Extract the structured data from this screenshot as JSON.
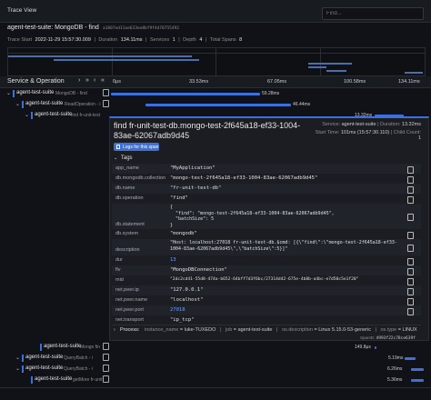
{
  "panel": {
    "title": "Trace View"
  },
  "search": {
    "placeholder": "Find..."
  },
  "trace": {
    "name": "agent-test-suite: MongoDB - find",
    "id": "a1807ed11ae633ee8bf9f4d70755492",
    "start_label": "Trace Start",
    "start_value": "2022-11-29 15:57:30.009",
    "duration_label": "Duration",
    "duration_value": "134.11ms",
    "services_label": "Services",
    "services_value": "1",
    "depth_label": "Depth",
    "depth_value": "4",
    "total_spans_label": "Total Spans",
    "total_spans_value": "8"
  },
  "header": {
    "col_label": "Service & Operation",
    "ticks": [
      "0μs",
      "33.53ms",
      "67.05ms",
      "100.58ms",
      "134.11ms"
    ]
  },
  "spans": [
    {
      "service": "agent-test-suite",
      "op": "MongoDB - find",
      "duration": "59.28ms",
      "depth": 0
    },
    {
      "service": "agent-test-suite",
      "op": "ReadOperation - i",
      "duration": "46.44ms",
      "depth": 1
    },
    {
      "service": "agent-test-suite",
      "op": "find fr-unit-test",
      "duration": "13.32ms",
      "depth": 2
    }
  ],
  "detail": {
    "title": "find fr-unit-test-db.mongo-test-2f645a18-ef33-1004-83ae-62067adb9d45",
    "logs_button": "Logs for this span",
    "service_label": "Service:",
    "service_value": "agent-test-suite",
    "duration_label": "Duration:",
    "duration_value": "13.32ms",
    "start_label": "Start Time:",
    "start_value": "101ms (15:57:30.110)",
    "child_label": "Child Count:",
    "child_value": "1",
    "tags_label": "Tags",
    "tags": [
      {
        "key": "app_name",
        "value": "\"MyApplication\""
      },
      {
        "key": "db.mongodb.collection",
        "value": "\"mongo-test-2f645a18-ef33-1004-83ae-62067adb9d45\""
      },
      {
        "key": "db.name",
        "value": "\"fr-unit-test-db\""
      },
      {
        "key": "db.operation",
        "value": "\"find\""
      },
      {
        "key": "db.statement",
        "value": "{\n  \"find\": \"mongo-test-2f645a18-ef33-1004-83ae-62067adb9d45\",\n  \"batchSize\": 5\n}"
      },
      {
        "key": "db.system",
        "value": "\"mongodb\""
      },
      {
        "key": "description",
        "value": "\"Host: localhost:27018 fr-unit-test-db.$cmd: [{\\\"find\\\":\\\"mongo-test-2f645a18-ef33-1004-83ae-62067adb9d45\\\",\\\"batchSize\\\":5}]\""
      },
      {
        "key": "dur",
        "value": "13"
      },
      {
        "key": "flv",
        "value": "\"MongoDBConnection\""
      },
      {
        "key": "mid",
        "value": "\"2dc2cd41-55d8-474a-b652-64bff7d3f6bc/27314d42-675e-4b8b-a4bc-e7d50c5e1f20\""
      },
      {
        "key": "net.peer.ip",
        "value": "\"127.0.0.1\""
      },
      {
        "key": "net.peer.name",
        "value": "\"localhost\""
      },
      {
        "key": "net.peer.port",
        "value": "27018"
      },
      {
        "key": "net.transport",
        "value": "\"ip_tcp\""
      }
    ],
    "process_label": "Process:",
    "process": [
      {
        "key": "instance_name",
        "value": "luke-TUXEDO"
      },
      {
        "key": "job",
        "value": "agent-test-suite"
      },
      {
        "key": "os.description",
        "value": "Linux 5.15.0-53-generic"
      },
      {
        "key": "os.type",
        "value": "LINUX"
      }
    ],
    "span_id_label": "SpanID:",
    "span_id_value": "4993f22c78ce639f"
  },
  "bottom_spans": [
    {
      "service": "agent-test-suite",
      "op": "Mongo fin",
      "duration": "149.8μs"
    },
    {
      "service": "agent-test-suite",
      "op": "QueryBatch - i",
      "duration": "5.19ms"
    },
    {
      "service": "agent-test-suite",
      "op": "QueryBatch - i",
      "duration": "6.26ms"
    },
    {
      "service": "agent-test-suite",
      "op": "getMore fr-unit",
      "duration": "5.36ms"
    }
  ]
}
